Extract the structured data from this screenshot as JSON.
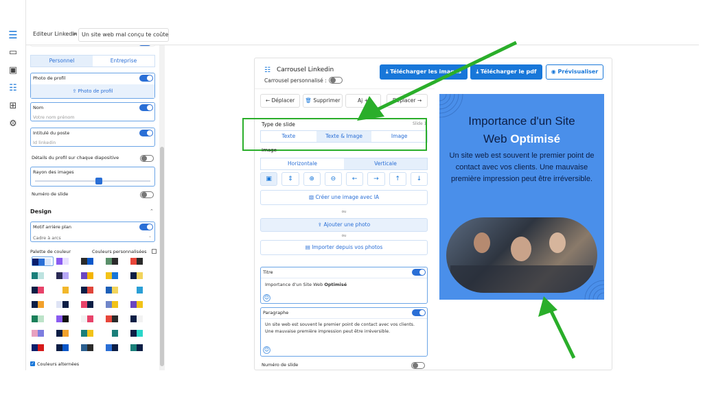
{
  "breadcrumb": {
    "root": "Editeur Linkedin",
    "sep": ">",
    "current": "Un site web mal conçu te coûte c"
  },
  "left_panel": {
    "tabs": [
      "Personnel",
      "Entreprise"
    ],
    "photo_label": "Photo de profil",
    "photo_button": "Photo de profil",
    "name_label": "Nom",
    "name_placeholder": "Votre nom prénom",
    "job_label": "Intitulé du poste",
    "job_placeholder": "Id linkedin",
    "details_label": "Détails du profil sur chaque diapositive",
    "radius_label": "Rayon des images",
    "radius_value": 0.55,
    "slide_number_label": "Numéro de slide",
    "design_heading": "Design",
    "motif_label": "Motif arrière plan",
    "motif_value": "Cadre à arcs",
    "palette_label": "Palette de couleur",
    "custom_colors_label": "Couleurs personnalisées",
    "alternate_colors_label": "Couleurs alternées"
  },
  "palettes": [
    [
      "#0b1e6b",
      "#2a6fd6",
      "#dbe7fb"
    ],
    [
      "#8a5cf0",
      "#e8e0ff"
    ],
    [
      "#2b2b2b",
      "#0a58ca"
    ],
    [
      "#5a8f6a",
      "#2b2b2b"
    ],
    [
      "#e8463a",
      "#2b2b2b"
    ],
    [
      "#1a7f7a",
      "#bde3e0"
    ],
    [
      "#2a2a55",
      "#b6a7f7"
    ],
    [
      "#6b46c1",
      "#f4b400"
    ],
    [
      "#f3c318",
      "#1877d9"
    ],
    [
      "#0c1e45",
      "#f2d45c"
    ],
    [
      "#0c1e45",
      "#e8436a"
    ],
    [
      "#fff",
      "#f2b72b"
    ],
    [
      "#0c1e45",
      "#e0453a"
    ],
    [
      "#1c5fb8",
      "#f2d45c"
    ],
    [
      "#fff",
      "#2a9fd6"
    ],
    [
      "#0c1e45",
      "#f2a12b"
    ],
    [
      "#dfe4f5",
      "#0c1e45"
    ],
    [
      "#e8436a",
      "#0c1e45"
    ],
    [
      "#7086c9",
      "#f2c318"
    ],
    [
      "#6b46c1",
      "#f2c318"
    ],
    [
      "#1a7f5a",
      "#bde3c9"
    ],
    [
      "#8a5cf0",
      "#111"
    ],
    [
      "#f2f2f2",
      "#e8436a"
    ],
    [
      "#e8463a",
      "#2b2b2b"
    ],
    [
      "#0c1e45",
      "#f2f2f2"
    ],
    [
      "#e8a0c0",
      "#7d7de0"
    ],
    [
      "#0c1e45",
      "#f2a12b"
    ],
    [
      "#1a7f7a",
      "#f2c318"
    ],
    [
      "#fff",
      "#1a7f7a"
    ],
    [
      "#0c1e45",
      "#2ad6c9"
    ],
    [
      "#0b1e6b",
      "#d61a1a"
    ],
    [
      "#0c1e45",
      "#0a58ca"
    ],
    [
      "#2b5f8f",
      "#2b2b2b"
    ],
    [
      "#2a6fd6",
      "#0c1e45"
    ],
    [
      "#1a7f7a",
      "#0c1e45"
    ]
  ],
  "toolbar": {
    "title": "Carrousel Linkedin",
    "custom_label": "Carrousel personnalisé :",
    "download_images": "Télécharger les images",
    "download_pdf": "Télécharger le pdf",
    "preview": "Prévisualiser"
  },
  "slide_actions": {
    "move_left": "Déplacer",
    "delete": "Supprimer",
    "add": "Aj",
    "move_right": "Déplacer"
  },
  "slide_type": {
    "label": "Type de slide",
    "slide": "Slide 1",
    "options": [
      "Texte",
      "Texte & Image",
      "Image"
    ],
    "selected": "Texte & Image"
  },
  "image_section": {
    "label": "Image",
    "orientation": [
      "Horizontale",
      "Verticale"
    ],
    "create_ai": "Créer une image avec IA",
    "or1": "ou",
    "add_photo": "Ajouter une photo",
    "or2": "ou",
    "import_photos": "Importer depuis vos photos"
  },
  "title_box": {
    "label": "Titre",
    "prefix": "Importance d'un Site Web ",
    "bold": "Optimisé"
  },
  "paragraph_box": {
    "label": "Paragraphe",
    "text": "Un site web est souvent le premier point de contact avec vos clients. Une mauvaise première impression peut être irréversible."
  },
  "slide_number_label": "Numéro de slide",
  "preview": {
    "title_line1": "Importance d'un Site",
    "title_line2_plain": "Web ",
    "title_line2_bold": "Optimisé",
    "body": "Un site web est souvent le premier point de contact avec vos clients. Une mauvaise première impression peut être irréversible."
  },
  "colors": {
    "accent": "#1877d9",
    "preview_bg": "#4a8fea",
    "highlight": "#2aae2a"
  }
}
